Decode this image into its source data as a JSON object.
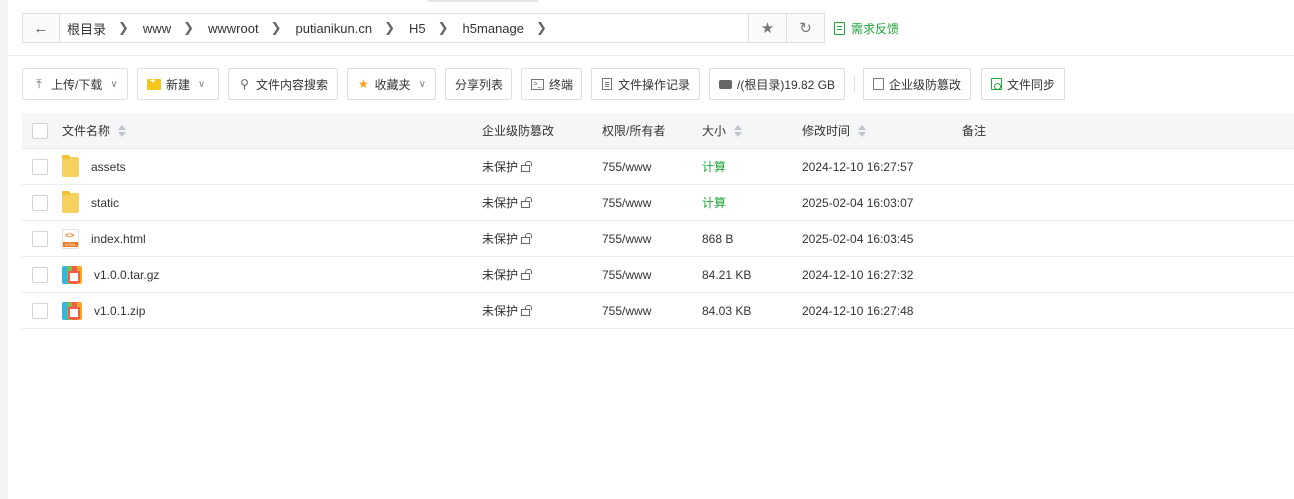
{
  "address_bar": {
    "back_icon": "arrow-left-icon",
    "crumbs": [
      "根目录",
      "www",
      "wwwroot",
      "putianikun.cn",
      "H5",
      "h5manage"
    ],
    "star_icon": "star-icon",
    "refresh_icon": "refresh-icon"
  },
  "feedback_label": "需求反馈",
  "toolbar": {
    "upload": "上传/下载",
    "new": "新建",
    "search": "文件内容搜索",
    "favorites": "收藏夹",
    "share_list": "分享列表",
    "terminal": "终端",
    "op_log": "文件操作记录",
    "disk": "/(根目录)19.82 GB",
    "tamper": "企业级防篡改",
    "sync": "文件同步"
  },
  "table": {
    "headers": {
      "name": "文件名称",
      "tamper": "企业级防篡改",
      "perm": "权限/所有者",
      "size": "大小",
      "mtime": "修改时间",
      "note": "备注"
    },
    "rows": [
      {
        "name": "assets",
        "icon": "folder-icon",
        "tamper": "未保护",
        "perm": "755/www",
        "size": "计算",
        "mtime": "2024-12-10 16:27:57",
        "note": ""
      },
      {
        "name": "static",
        "icon": "folder-icon",
        "tamper": "未保护",
        "perm": "755/www",
        "size": "计算",
        "mtime": "2025-02-04 16:03:07",
        "note": ""
      },
      {
        "name": "index.html",
        "icon": "html-file-icon",
        "tamper": "未保护",
        "perm": "755/www",
        "size": "868 B",
        "mtime": "2025-02-04 16:03:45",
        "note": ""
      },
      {
        "name": "v1.0.0.tar.gz",
        "icon": "archive-icon",
        "tamper": "未保护",
        "perm": "755/www",
        "size": "84.21 KB",
        "mtime": "2024-12-10 16:27:32",
        "note": ""
      },
      {
        "name": "v1.0.1.zip",
        "icon": "archive-icon",
        "tamper": "未保护",
        "perm": "755/www",
        "size": "84.03 KB",
        "mtime": "2024-12-10 16:27:48",
        "note": ""
      }
    ]
  },
  "colors": {
    "accent": "#20a53a",
    "border": "#dcdfe6",
    "header_bg": "#f5f6f7"
  }
}
